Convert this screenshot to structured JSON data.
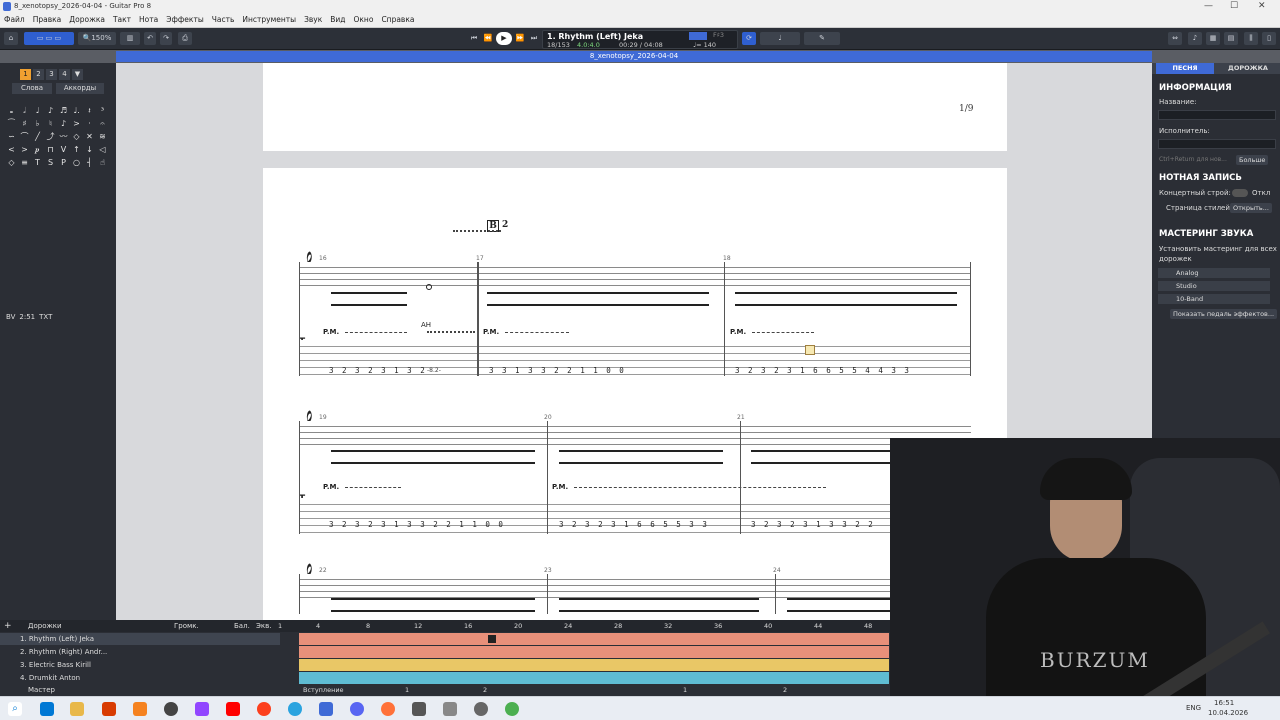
{
  "window": {
    "title": "8_xenotopsy_2026-04-04 - Guitar Pro 8",
    "document_tab": "8_xenotopsy_2026-04-04"
  },
  "menu": [
    "Файл",
    "Правка",
    "Дорожка",
    "Такт",
    "Нота",
    "Эффекты",
    "Часть",
    "Инструменты",
    "Звук",
    "Вид",
    "Окно",
    "Справка"
  ],
  "toolbar": {
    "zoom": "150%",
    "track_name": "1. Rhythm (Left) Jeka",
    "bar_pos": "18/153",
    "time_sig": "4.0:4.0",
    "time": "00:29 / 04:08",
    "tempo_marker": "♩= 140",
    "key_marker": "F♯3"
  },
  "left_panel": {
    "voice_tabs": [
      "1",
      "2",
      "3",
      "4"
    ],
    "lyrics_btn": "Слова",
    "chords_btn": "Аккорды",
    "text_items": [
      "BV",
      "2:51",
      "TXT"
    ]
  },
  "score": {
    "page_number": "1/9",
    "section_marker": "B",
    "section_number": "2",
    "bar_numbers": [
      "16",
      "17",
      "18",
      "19",
      "20",
      "21",
      "22",
      "23",
      "24"
    ],
    "palm_mute": "P.M.",
    "harmonic": "AH",
    "bend": "-8.2-",
    "tab_row1": {
      "b16": "3 2 3 2 3 1 3 2",
      "b17": "3 3 1 3 3 2 2 1 1 0 0",
      "b18": "3 2 3 2 3 1 6 6 5 5 4 4 3 3"
    },
    "tab_row2": {
      "b19": "3 2 3 2 3 1 3 3 2 2 1 1 0 0",
      "b20": "3 2 3 2 3 1 6 6 5 5 3 3",
      "b21": "3 2 3 2 3 1 3 3 2 2"
    }
  },
  "right_panel": {
    "tab_song": "ПЕСНЯ",
    "tab_track": "ДОРОЖКА",
    "info_title": "ИНФОРМАЦИЯ",
    "name_label": "Название:",
    "artist_label": "Исполнитель:",
    "hint": "Ctrl+Return для нов...",
    "more_btn": "Больше",
    "notation_title": "НОТНАЯ ЗАПИСЬ",
    "concert_pitch": "Концертный строй:",
    "concert_off": "Откл",
    "stylesheet": "Страница стилей:",
    "open_btn": "Открыть...",
    "mastering_title": "МАСТЕРИНГ ЗВУКА",
    "mastering_desc": "Установить мастеринг для всех дорожек",
    "effects": [
      "Analog",
      "Studio",
      "10-Band"
    ],
    "pedal_btn": "Показать педаль эффектов..."
  },
  "tracks": {
    "header": "Дорожки",
    "vol": "Громк.",
    "pan": "Бал.",
    "eq": "Экв.",
    "rows": [
      "1. Rhythm (Left) Jeka",
      "2. Rhythm (Right) Andr...",
      "3. Electric Bass Kirill",
      "4. Drumkit Anton"
    ],
    "master": "Мастер",
    "timeline": [
      "1",
      "4",
      "8",
      "12",
      "16",
      "20",
      "24",
      "28",
      "32",
      "36",
      "40",
      "44",
      "48"
    ],
    "sections": [
      "Вступление",
      "1",
      "2",
      "",
      "1",
      "2"
    ]
  },
  "colors": {
    "accent": "#3f6ad6",
    "track1": "#e8907a",
    "track2": "#e8907a",
    "track3": "#e9c766",
    "track4": "#5fbcd3"
  },
  "taskbar": {
    "time": "16:51",
    "date": "10.04.2026",
    "lang": "ENG"
  },
  "webcam": {
    "shirt_text": "BURZUM"
  }
}
